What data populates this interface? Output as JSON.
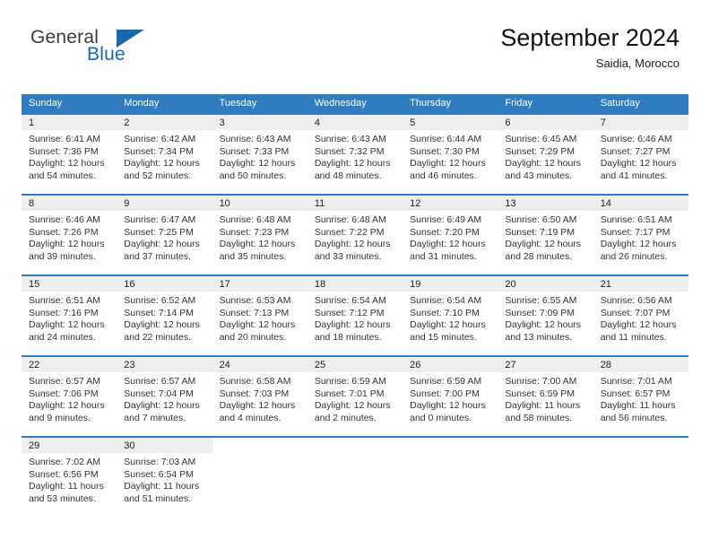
{
  "brand": {
    "name_part1": "General",
    "name_part2": "Blue",
    "accent_color": "#1569b0"
  },
  "header": {
    "title": "September 2024",
    "subtitle": "Saidia, Morocco"
  },
  "theme": {
    "header_row_color": "#2f7cc0",
    "daynum_band_color": "#eeeeee",
    "text_color": "#333333"
  },
  "weekday_headers": [
    "Sunday",
    "Monday",
    "Tuesday",
    "Wednesday",
    "Thursday",
    "Friday",
    "Saturday"
  ],
  "weeks": [
    [
      {
        "day": "1",
        "sunrise": "Sunrise: 6:41 AM",
        "sunset": "Sunset: 7:36 PM",
        "daylight_1": "Daylight: 12 hours",
        "daylight_2": "and 54 minutes."
      },
      {
        "day": "2",
        "sunrise": "Sunrise: 6:42 AM",
        "sunset": "Sunset: 7:34 PM",
        "daylight_1": "Daylight: 12 hours",
        "daylight_2": "and 52 minutes."
      },
      {
        "day": "3",
        "sunrise": "Sunrise: 6:43 AM",
        "sunset": "Sunset: 7:33 PM",
        "daylight_1": "Daylight: 12 hours",
        "daylight_2": "and 50 minutes."
      },
      {
        "day": "4",
        "sunrise": "Sunrise: 6:43 AM",
        "sunset": "Sunset: 7:32 PM",
        "daylight_1": "Daylight: 12 hours",
        "daylight_2": "and 48 minutes."
      },
      {
        "day": "5",
        "sunrise": "Sunrise: 6:44 AM",
        "sunset": "Sunset: 7:30 PM",
        "daylight_1": "Daylight: 12 hours",
        "daylight_2": "and 46 minutes."
      },
      {
        "day": "6",
        "sunrise": "Sunrise: 6:45 AM",
        "sunset": "Sunset: 7:29 PM",
        "daylight_1": "Daylight: 12 hours",
        "daylight_2": "and 43 minutes."
      },
      {
        "day": "7",
        "sunrise": "Sunrise: 6:46 AM",
        "sunset": "Sunset: 7:27 PM",
        "daylight_1": "Daylight: 12 hours",
        "daylight_2": "and 41 minutes."
      }
    ],
    [
      {
        "day": "8",
        "sunrise": "Sunrise: 6:46 AM",
        "sunset": "Sunset: 7:26 PM",
        "daylight_1": "Daylight: 12 hours",
        "daylight_2": "and 39 minutes."
      },
      {
        "day": "9",
        "sunrise": "Sunrise: 6:47 AM",
        "sunset": "Sunset: 7:25 PM",
        "daylight_1": "Daylight: 12 hours",
        "daylight_2": "and 37 minutes."
      },
      {
        "day": "10",
        "sunrise": "Sunrise: 6:48 AM",
        "sunset": "Sunset: 7:23 PM",
        "daylight_1": "Daylight: 12 hours",
        "daylight_2": "and 35 minutes."
      },
      {
        "day": "11",
        "sunrise": "Sunrise: 6:48 AM",
        "sunset": "Sunset: 7:22 PM",
        "daylight_1": "Daylight: 12 hours",
        "daylight_2": "and 33 minutes."
      },
      {
        "day": "12",
        "sunrise": "Sunrise: 6:49 AM",
        "sunset": "Sunset: 7:20 PM",
        "daylight_1": "Daylight: 12 hours",
        "daylight_2": "and 31 minutes."
      },
      {
        "day": "13",
        "sunrise": "Sunrise: 6:50 AM",
        "sunset": "Sunset: 7:19 PM",
        "daylight_1": "Daylight: 12 hours",
        "daylight_2": "and 28 minutes."
      },
      {
        "day": "14",
        "sunrise": "Sunrise: 6:51 AM",
        "sunset": "Sunset: 7:17 PM",
        "daylight_1": "Daylight: 12 hours",
        "daylight_2": "and 26 minutes."
      }
    ],
    [
      {
        "day": "15",
        "sunrise": "Sunrise: 6:51 AM",
        "sunset": "Sunset: 7:16 PM",
        "daylight_1": "Daylight: 12 hours",
        "daylight_2": "and 24 minutes."
      },
      {
        "day": "16",
        "sunrise": "Sunrise: 6:52 AM",
        "sunset": "Sunset: 7:14 PM",
        "daylight_1": "Daylight: 12 hours",
        "daylight_2": "and 22 minutes."
      },
      {
        "day": "17",
        "sunrise": "Sunrise: 6:53 AM",
        "sunset": "Sunset: 7:13 PM",
        "daylight_1": "Daylight: 12 hours",
        "daylight_2": "and 20 minutes."
      },
      {
        "day": "18",
        "sunrise": "Sunrise: 6:54 AM",
        "sunset": "Sunset: 7:12 PM",
        "daylight_1": "Daylight: 12 hours",
        "daylight_2": "and 18 minutes."
      },
      {
        "day": "19",
        "sunrise": "Sunrise: 6:54 AM",
        "sunset": "Sunset: 7:10 PM",
        "daylight_1": "Daylight: 12 hours",
        "daylight_2": "and 15 minutes."
      },
      {
        "day": "20",
        "sunrise": "Sunrise: 6:55 AM",
        "sunset": "Sunset: 7:09 PM",
        "daylight_1": "Daylight: 12 hours",
        "daylight_2": "and 13 minutes."
      },
      {
        "day": "21",
        "sunrise": "Sunrise: 6:56 AM",
        "sunset": "Sunset: 7:07 PM",
        "daylight_1": "Daylight: 12 hours",
        "daylight_2": "and 11 minutes."
      }
    ],
    [
      {
        "day": "22",
        "sunrise": "Sunrise: 6:57 AM",
        "sunset": "Sunset: 7:06 PM",
        "daylight_1": "Daylight: 12 hours",
        "daylight_2": "and 9 minutes."
      },
      {
        "day": "23",
        "sunrise": "Sunrise: 6:57 AM",
        "sunset": "Sunset: 7:04 PM",
        "daylight_1": "Daylight: 12 hours",
        "daylight_2": "and 7 minutes."
      },
      {
        "day": "24",
        "sunrise": "Sunrise: 6:58 AM",
        "sunset": "Sunset: 7:03 PM",
        "daylight_1": "Daylight: 12 hours",
        "daylight_2": "and 4 minutes."
      },
      {
        "day": "25",
        "sunrise": "Sunrise: 6:59 AM",
        "sunset": "Sunset: 7:01 PM",
        "daylight_1": "Daylight: 12 hours",
        "daylight_2": "and 2 minutes."
      },
      {
        "day": "26",
        "sunrise": "Sunrise: 6:59 AM",
        "sunset": "Sunset: 7:00 PM",
        "daylight_1": "Daylight: 12 hours",
        "daylight_2": "and 0 minutes."
      },
      {
        "day": "27",
        "sunrise": "Sunrise: 7:00 AM",
        "sunset": "Sunset: 6:59 PM",
        "daylight_1": "Daylight: 11 hours",
        "daylight_2": "and 58 minutes."
      },
      {
        "day": "28",
        "sunrise": "Sunrise: 7:01 AM",
        "sunset": "Sunset: 6:57 PM",
        "daylight_1": "Daylight: 11 hours",
        "daylight_2": "and 56 minutes."
      }
    ],
    [
      {
        "day": "29",
        "sunrise": "Sunrise: 7:02 AM",
        "sunset": "Sunset: 6:56 PM",
        "daylight_1": "Daylight: 11 hours",
        "daylight_2": "and 53 minutes."
      },
      {
        "day": "30",
        "sunrise": "Sunrise: 7:03 AM",
        "sunset": "Sunset: 6:54 PM",
        "daylight_1": "Daylight: 11 hours",
        "daylight_2": "and 51 minutes."
      },
      {
        "day": "",
        "sunrise": "",
        "sunset": "",
        "daylight_1": "",
        "daylight_2": ""
      },
      {
        "day": "",
        "sunrise": "",
        "sunset": "",
        "daylight_1": "",
        "daylight_2": ""
      },
      {
        "day": "",
        "sunrise": "",
        "sunset": "",
        "daylight_1": "",
        "daylight_2": ""
      },
      {
        "day": "",
        "sunrise": "",
        "sunset": "",
        "daylight_1": "",
        "daylight_2": ""
      },
      {
        "day": "",
        "sunrise": "",
        "sunset": "",
        "daylight_1": "",
        "daylight_2": ""
      }
    ]
  ]
}
